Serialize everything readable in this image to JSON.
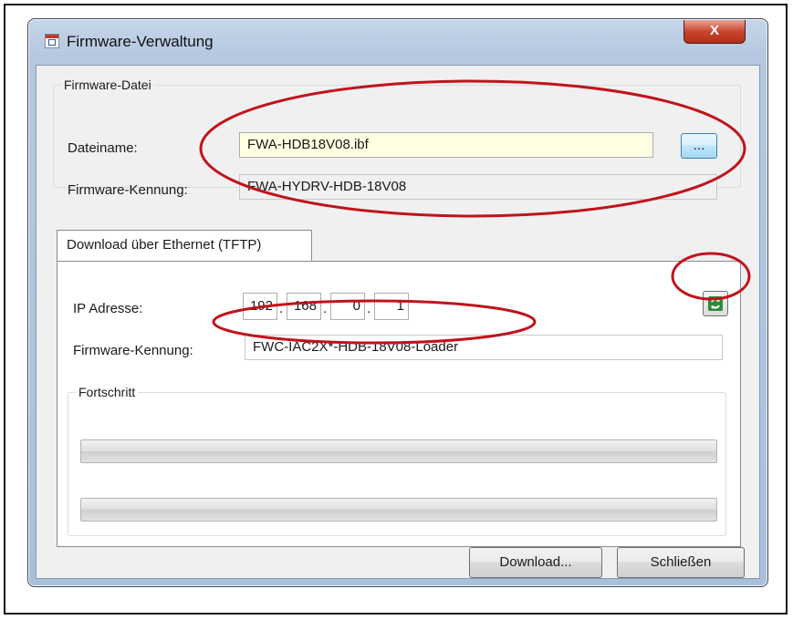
{
  "window": {
    "title": "Firmware-Verwaltung",
    "close_glyph": "X"
  },
  "firmware_file": {
    "group_label": "Firmware-Datei",
    "filename_label": "Dateiname:",
    "filename_value": "FWA-HDB18V08.ibf",
    "browse_label": "...",
    "id_label": "Firmware-Kennung:",
    "id_value": "FWA-HYDRV-HDB-18V08"
  },
  "tab": {
    "label": "Download über Ethernet (TFTP)"
  },
  "ethernet": {
    "ip_label": "IP Adresse:",
    "ip_octets": [
      "192",
      "168",
      "0",
      "1"
    ],
    "refresh_icon": "refresh-icon",
    "id_label": "Firmware-Kennung:",
    "id_value": "FWC-IAC2X*-HDB-18V08-Loader"
  },
  "progress": {
    "group_label": "Fortschritt",
    "bar1_fraction": 0,
    "bar2_fraction": 0
  },
  "footer": {
    "download_label": "Download...",
    "close_label": "Schließen"
  },
  "colors": {
    "annotation_red": "#c0131b",
    "input_highlight": "#ffffe1"
  }
}
